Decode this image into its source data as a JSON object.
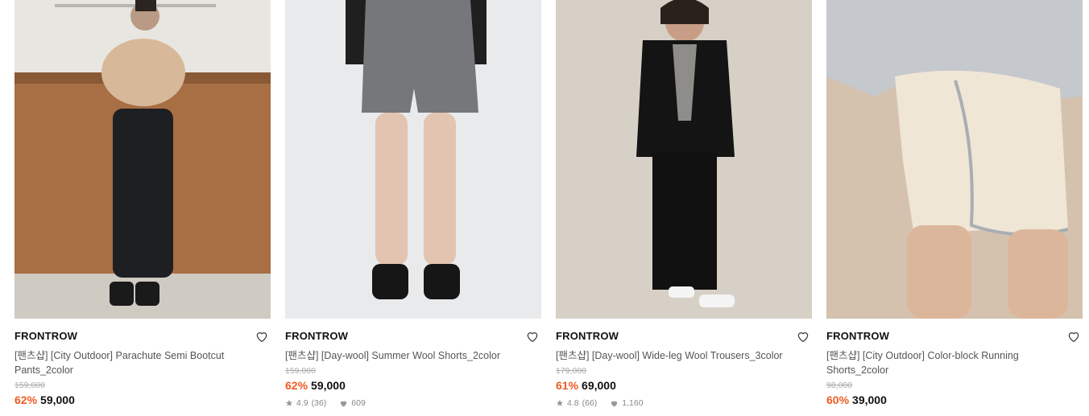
{
  "products": [
    {
      "brand": "FRONTROW",
      "name": "[팬츠샵] [City Outdoor] Parachute Semi Bootcut Pants_2color",
      "original_price": "159,000",
      "discount": "62%",
      "price": "59,000",
      "image_icon": "product-photo-black-parachute-pants"
    },
    {
      "brand": "FRONTROW",
      "name": "[팬츠샵] [Day-wool] Summer Wool Shorts_2color",
      "original_price": "159,000",
      "discount": "62%",
      "price": "59,000",
      "rating": "4.9",
      "reviews": "(36)",
      "likes": "609",
      "image_icon": "product-photo-grey-wool-shorts"
    },
    {
      "brand": "FRONTROW",
      "name": "[팬츠샵] [Day-wool] Wide-leg Wool Trousers_3color",
      "original_price": "179,000",
      "discount": "61%",
      "price": "69,000",
      "rating": "4.8",
      "reviews": "(66)",
      "likes": "1,160",
      "image_icon": "product-photo-black-wide-trousers"
    },
    {
      "brand": "FRONTROW",
      "name": "[팬츠샵] [City Outdoor] Color-block Running Shorts_2color",
      "original_price": "98,000",
      "discount": "60%",
      "price": "39,000",
      "image_icon": "product-photo-ivory-running-shorts"
    }
  ],
  "colors": {
    "discount": "#f05a22",
    "accent": "#111111"
  }
}
